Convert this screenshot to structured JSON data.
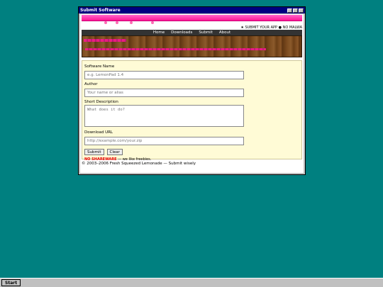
{
  "window": {
    "title": "Submit Software",
    "controls": [
      "minimize-icon",
      "maximize-icon",
      "close-icon"
    ]
  },
  "ticker": "★ SUBMIT YOUR APP ● NO MALWA",
  "nav": {
    "items": [
      {
        "label": "Home"
      },
      {
        "label": "Downloads"
      },
      {
        "label": "Submit"
      },
      {
        "label": "About"
      }
    ]
  },
  "form": {
    "name_label": "Software Name",
    "name_placeholder": "e.g. LemonPad 1.4",
    "author_label": "Author",
    "author_placeholder": "Your name or alias",
    "desc_label": "Short Description",
    "desc_placeholder": "What does it do?",
    "url_label": "Download URL",
    "url_placeholder": "http://example.com/your.zip",
    "submit_label": "Submit",
    "clear_label": "Clear",
    "note_warn": "NO SHAREWARE",
    "note_rest": " — we like freebies."
  },
  "footer": "© 2003–2006 Fresh Squeezed Lemonade — Submit wisely",
  "taskbar": {
    "start_label": "Start"
  },
  "colors": {
    "desktop": "#008080",
    "titlebar": "#000080",
    "banner": "#ff1493",
    "panel": "#fffbd6",
    "warn": "#e00000"
  }
}
